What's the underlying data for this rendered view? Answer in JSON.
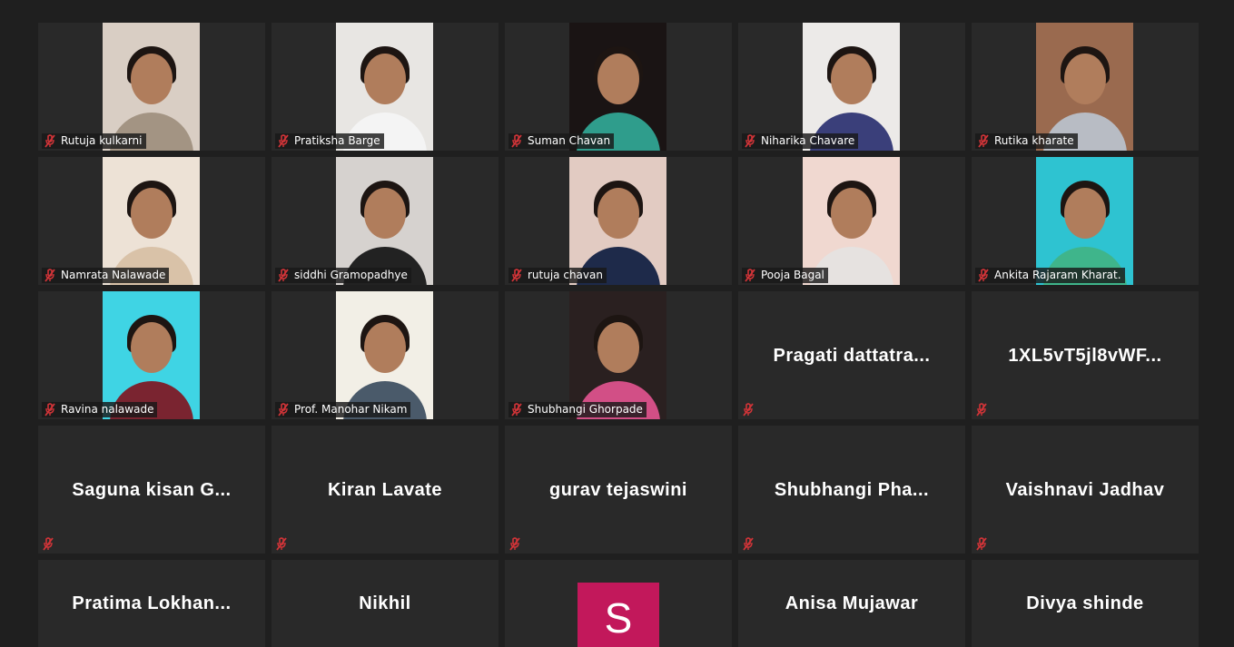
{
  "meeting": {
    "participants": [
      {
        "name": "Rutuja kulkarni",
        "video": true,
        "muted": true,
        "wall": "#d9cec4",
        "outfit": "#a39483"
      },
      {
        "name": "Pratiksha Barge",
        "video": true,
        "muted": true,
        "wall": "#e8e6e3",
        "outfit": "#f4f4f4"
      },
      {
        "name": "Suman Chavan",
        "video": true,
        "muted": true,
        "wall": "#1a1414",
        "outfit": "#2f9d8c"
      },
      {
        "name": "Niharika Chavare",
        "video": true,
        "muted": true,
        "wall": "#eceae8",
        "outfit": "#3a3f7a"
      },
      {
        "name": "Rutika kharate",
        "video": true,
        "muted": true,
        "wall": "#9a6a4f",
        "outfit": "#b8bcc4"
      },
      {
        "name": "Namrata Nalawade",
        "video": true,
        "muted": true,
        "wall": "#ede2d6",
        "outfit": "#d9c2a8"
      },
      {
        "name": "siddhi Gramopadhye",
        "video": true,
        "muted": true,
        "wall": "#d6d2cf",
        "outfit": "#222222"
      },
      {
        "name": "rutuja chavan",
        "video": true,
        "muted": true,
        "wall": "#e2cbc2",
        "outfit": "#1e2a4a"
      },
      {
        "name": "Pooja Bagal",
        "video": true,
        "muted": true,
        "wall": "#f0d8d0",
        "outfit": "#e6e2e0"
      },
      {
        "name": "Ankita Rajaram Kharat.",
        "video": true,
        "muted": true,
        "wall": "#2ec3d1",
        "outfit": "#3fb58b"
      },
      {
        "name": "Ravina nalawade",
        "video": true,
        "muted": true,
        "wall": "#3fd4e4",
        "outfit": "#7a2430"
      },
      {
        "name": "Prof. Manohar Nikam",
        "video": true,
        "muted": true,
        "wall": "#f2efe6",
        "outfit": "#4a5a6a"
      },
      {
        "name": "Shubhangi Ghorpade",
        "video": true,
        "muted": true,
        "wall": "#2a2020",
        "outfit": "#d24f86"
      },
      {
        "name": "Pragati  dattatra...",
        "video": false,
        "muted": true
      },
      {
        "name": "1XL5vT5jl8vWF...",
        "video": false,
        "muted": true
      },
      {
        "name": "Saguna kisan G...",
        "video": false,
        "muted": true
      },
      {
        "name": "Kiran Lavate",
        "video": false,
        "muted": true
      },
      {
        "name": "gurav tejaswini",
        "video": false,
        "muted": true
      },
      {
        "name": "Shubhangi  Pha...",
        "video": false,
        "muted": true
      },
      {
        "name": "Vaishnavi Jadhav",
        "video": false,
        "muted": true
      },
      {
        "name": "Pratima  Lokhan...",
        "video": false,
        "muted": false
      },
      {
        "name": "Nikhil",
        "video": false,
        "muted": false
      },
      {
        "name": "",
        "video": false,
        "muted": false,
        "avatar_letter": "S",
        "avatar_color": "#c2185b"
      },
      {
        "name": "Anisa Mujawar",
        "video": false,
        "muted": false
      },
      {
        "name": "Divya shinde",
        "video": false,
        "muted": false
      }
    ]
  },
  "colors": {
    "background": "#1f1f1f",
    "tile": "#292929",
    "muted_mic": "#d13438",
    "text": "#ffffff"
  }
}
